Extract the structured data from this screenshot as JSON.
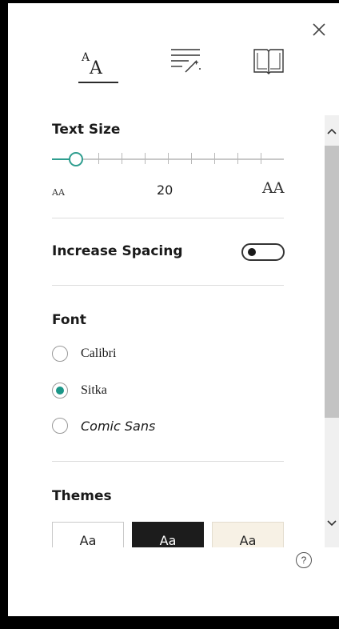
{
  "header": {
    "close_icon": "close-icon",
    "tabs": [
      {
        "name": "text-preferences",
        "icon": "text-preferences-icon",
        "label": "ᴬA",
        "selected": true
      },
      {
        "name": "grammar-options",
        "icon": "grammar-options-icon",
        "selected": false
      },
      {
        "name": "reading-preferences",
        "icon": "book-icon",
        "selected": false
      }
    ]
  },
  "text_size": {
    "title": "Text Size",
    "value": "20",
    "small_label": "AA",
    "large_label": "AA",
    "slider_level": 0.08
  },
  "spacing": {
    "label": "Increase Spacing",
    "enabled": false
  },
  "font": {
    "title": "Font",
    "options": [
      {
        "label": "Calibri",
        "selected": false
      },
      {
        "label": "Sitka",
        "selected": true
      },
      {
        "label": "Comic Sans",
        "selected": false
      }
    ]
  },
  "themes": {
    "title": "Themes",
    "options": [
      {
        "label": "Aa",
        "style": "light"
      },
      {
        "label": "Aa",
        "style": "dark"
      },
      {
        "label": "Aa",
        "style": "sepia"
      }
    ]
  },
  "footer": {
    "help_label": "?"
  },
  "colors": {
    "accent": "#1b9688",
    "background": "#ffffff",
    "frame": "#000000"
  }
}
